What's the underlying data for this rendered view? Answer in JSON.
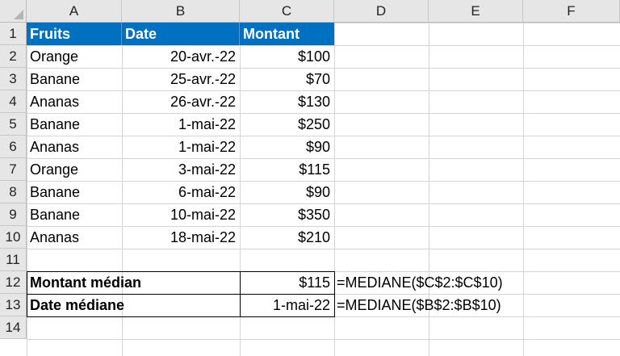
{
  "columns": [
    "A",
    "B",
    "C",
    "D",
    "E",
    "F"
  ],
  "rows": [
    "1",
    "2",
    "3",
    "4",
    "5",
    "6",
    "7",
    "8",
    "9",
    "10",
    "11",
    "12",
    "13",
    "14"
  ],
  "header": {
    "fruits": "Fruits",
    "date": "Date",
    "montant": "Montant"
  },
  "data": [
    {
      "fruit": "Orange",
      "date": "20-avr.-22",
      "montant": "$100"
    },
    {
      "fruit": "Banane",
      "date": "25-avr.-22",
      "montant": "$70"
    },
    {
      "fruit": "Ananas",
      "date": "26-avr.-22",
      "montant": "$130"
    },
    {
      "fruit": "Banane",
      "date": "1-mai-22",
      "montant": "$250"
    },
    {
      "fruit": "Ananas",
      "date": "1-mai-22",
      "montant": "$90"
    },
    {
      "fruit": "Orange",
      "date": "3-mai-22",
      "montant": "$115"
    },
    {
      "fruit": "Banane",
      "date": "6-mai-22",
      "montant": "$90"
    },
    {
      "fruit": "Banane",
      "date": "10-mai-22",
      "montant": "$350"
    },
    {
      "fruit": "Ananas",
      "date": "18-mai-22",
      "montant": "$210"
    }
  ],
  "summary": {
    "montant_label": "Montant médian",
    "montant_value": "$115",
    "montant_formula": "=MEDIANE($C$2:$C$10)",
    "date_label": "Date médiane",
    "date_value": "1-mai-22",
    "date_formula": "=MEDIANE($B$2:$B$10)"
  },
  "colors": {
    "header_fill": "#0070c0",
    "header_text": "#ffffff"
  }
}
